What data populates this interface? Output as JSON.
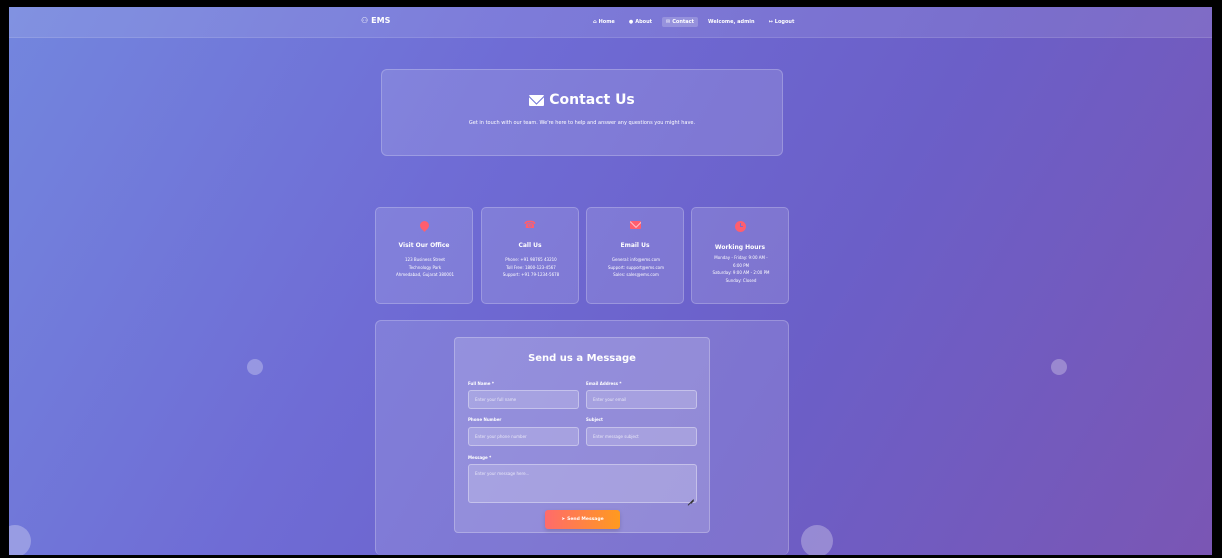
{
  "nav": {
    "brand": "EMS",
    "links": [
      {
        "label": "Home",
        "icon": "home-icon"
      },
      {
        "label": "About",
        "icon": "info-icon"
      },
      {
        "label": "Contact",
        "icon": "envelope-icon"
      },
      {
        "label": "Welcome, admin",
        "icon": ""
      },
      {
        "label": "Logout",
        "icon": "logout-icon"
      }
    ]
  },
  "hero": {
    "title": "Contact Us",
    "subtitle": "Get in touch with our team. We're here to help and answer any questions you might have."
  },
  "cards": [
    {
      "title": "Visit Our Office",
      "icon": "map-pin-icon",
      "lines": [
        "123 Business Street",
        "Technology Park",
        "Ahmedabad, Gujarat 380001"
      ]
    },
    {
      "title": "Call Us",
      "icon": "phone-icon",
      "lines": [
        "Phone: +91 98765 43210",
        "Toll Free: 1800-123-4567",
        "Support: +91 79-1234-5678"
      ]
    },
    {
      "title": "Email Us",
      "icon": "envelope-icon",
      "lines": [
        "General: info@ems.com",
        "Support: support@ems.com",
        "Sales: sales@ems.com"
      ]
    },
    {
      "title": "Working Hours",
      "icon": "clock-icon",
      "lines": [
        "Monday - Friday: 9:00 AM -",
        "6:00 PM",
        "Saturday: 9:00 AM - 2:00 PM",
        "Sunday: Closed"
      ]
    }
  ],
  "form": {
    "title": "Send us a Message",
    "full_name": {
      "label": "Full Name *",
      "placeholder": "Enter your full name"
    },
    "email": {
      "label": "Email Address *",
      "placeholder": "Enter your email"
    },
    "phone": {
      "label": "Phone Number",
      "placeholder": "Enter your phone number"
    },
    "subject": {
      "label": "Subject",
      "placeholder": "Enter message subject"
    },
    "message": {
      "label": "Message *",
      "placeholder": "Enter your message here..."
    },
    "submit_label": "Send Message"
  },
  "colors": {
    "accent": "#ff5e6e",
    "button_start": "#ff6b6b",
    "button_end": "#ff9a1f"
  }
}
